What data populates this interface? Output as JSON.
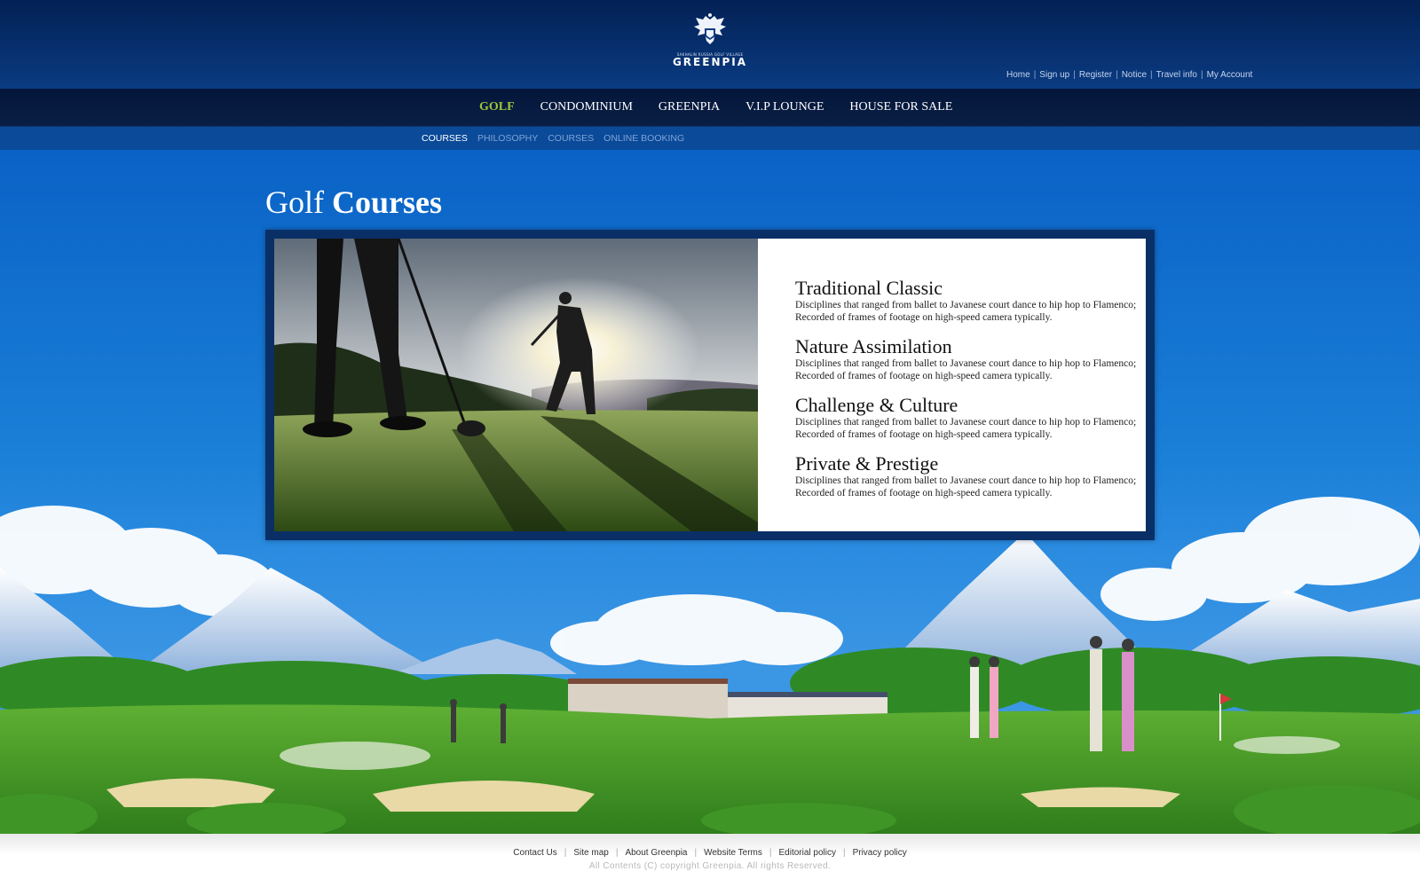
{
  "logo": {
    "small_text": "SAKHALIN RUSSIA GOLF VILLAGE",
    "wordmark": "GREENPIA",
    "icon": "eagle-crest-icon"
  },
  "util_links": [
    "Home",
    "Sign up",
    "Register",
    "Notice",
    "Travel info",
    "My Account"
  ],
  "main_nav": [
    {
      "label": "GOLF",
      "active": true
    },
    {
      "label": "CONDOMINIUM",
      "active": false
    },
    {
      "label": "GREENPIA",
      "active": false
    },
    {
      "label": "V.I.P LOUNGE",
      "active": false
    },
    {
      "label": "HOUSE FOR SALE",
      "active": false
    }
  ],
  "sub_nav": [
    {
      "label": "COURSES",
      "active": true
    },
    {
      "label": "PHILOSOPHY",
      "active": false
    },
    {
      "label": "COURSES",
      "active": false
    },
    {
      "label": "ONLINE BOOKING",
      "active": false
    }
  ],
  "page_title": {
    "light": "Golf",
    "bold": "Courses"
  },
  "features": [
    {
      "title": "Traditional Classic",
      "text": "Disciplines that ranged from ballet to Javanese court dance to hip hop to Flamenco; Recorded of frames of footage on high-speed camera typically."
    },
    {
      "title": "Nature Assimilation",
      "text": "Disciplines that ranged from ballet to Javanese court dance to hip hop to Flamenco; Recorded of frames of footage on high-speed camera typically."
    },
    {
      "title": "Challenge & Culture",
      "text": "Disciplines that ranged from ballet to Javanese court dance to hip hop to Flamenco; Recorded of frames of footage on high-speed camera typically."
    },
    {
      "title": "Private & Prestige",
      "text": "Disciplines that ranged from ballet to Javanese court dance to hip hop to Flamenco; Recorded of frames of footage on high-speed camera typically."
    }
  ],
  "footer": {
    "links": [
      "Contact Us",
      "Site map",
      "About Greenpia",
      "Website Terms",
      "Editorial policy",
      "Privacy policy"
    ],
    "copyright": "All Contents (C) copyright Greenpia. All rights Reserved."
  },
  "colors": {
    "header_dark": "#032154",
    "nav_active": "#9fc43a",
    "sky_blue": "#1466c4",
    "grass_green": "#4a9a2a"
  }
}
